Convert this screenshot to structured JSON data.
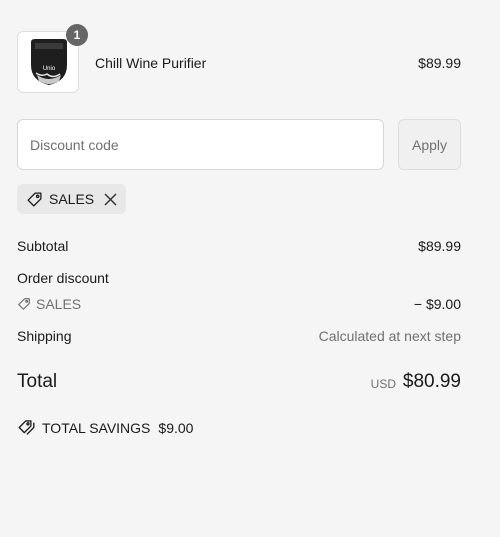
{
  "product": {
    "image_label": "Unio",
    "quantity": "1",
    "name": "Chill Wine Purifier",
    "price": "$89.99"
  },
  "discount": {
    "placeholder": "Discount code",
    "value": "",
    "apply_label": "Apply",
    "applied_code": "SALES"
  },
  "summary": {
    "subtotal_label": "Subtotal",
    "subtotal_value": "$89.99",
    "order_discount_label": "Order discount",
    "discount_code": "SALES",
    "discount_value": "− $9.00",
    "shipping_label": "Shipping",
    "shipping_value": "Calculated at next step",
    "total_label": "Total",
    "total_currency": "USD",
    "total_value": "$80.99",
    "savings_label": "TOTAL SAVINGS",
    "savings_value": "$9.00"
  },
  "icons": {
    "tag": "tag-icon",
    "close": "close-icon",
    "savings": "savings-tag-icon"
  },
  "colors": {
    "background": "#f5f5f5",
    "badge": "#666666",
    "muted_text": "#707070",
    "chip": "#e8e8e8"
  }
}
